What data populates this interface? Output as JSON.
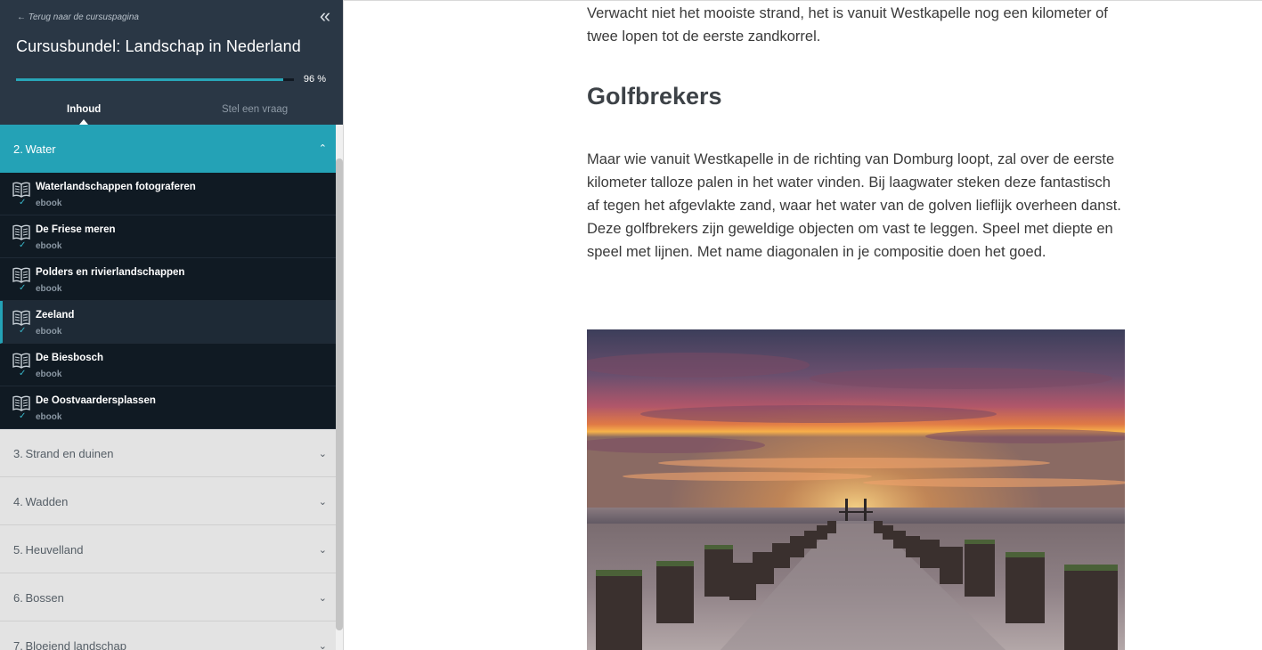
{
  "sidebar": {
    "back_label": "← Terug naar de cursuspagina",
    "collapse_icon": "double-chevron-left-icon",
    "course_title": "Cursusbundel: Landschap in Nederland",
    "progress": {
      "value": 0.96,
      "label": "96 %"
    },
    "tabs": [
      {
        "label": "Inhoud",
        "active": true
      },
      {
        "label": "Stel een vraag",
        "active": false
      }
    ],
    "active_section": {
      "label": "2. Water",
      "lessons": [
        {
          "title": "Waterlandschappen fotograferen",
          "type": "ebook",
          "icon": "open-book-icon",
          "done": true
        },
        {
          "title": "De Friese meren",
          "type": "ebook",
          "icon": "open-book-icon",
          "done": true
        },
        {
          "title": "Polders en rivierlandschappen",
          "type": "ebook",
          "icon": "open-book-icon",
          "done": true
        },
        {
          "title": "Zeeland",
          "type": "ebook",
          "icon": "open-book-icon",
          "done": true,
          "current": true
        },
        {
          "title": "De Biesbosch",
          "type": "ebook",
          "icon": "open-book-icon",
          "done": true
        },
        {
          "title": "De Oostvaardersplassen",
          "type": "ebook",
          "icon": "open-book-icon",
          "done": true
        }
      ]
    },
    "sections": [
      {
        "label": "3. Strand en duinen"
      },
      {
        "label": "4. Wadden"
      },
      {
        "label": "5. Heuvelland"
      },
      {
        "label": "6. Bossen"
      },
      {
        "label": "7. Bloeiend landschap"
      }
    ],
    "chevron_up": "⌃",
    "chevron_down": "⌄",
    "check_mark": "✓"
  },
  "main": {
    "intro_paragraph": "Verwacht niet het mooiste strand, het is vanuit Westkapelle nog een kilometer of twee lopen tot de eerste zandkorrel.",
    "heading": "Golfbrekers",
    "paragraph": "Maar wie vanuit Westkapelle in de richting van Domburg loopt, zal over de eerste kilometer talloze palen in het water vinden. Bij laagwater steken deze fantastisch af tegen het afgevlakte zand, waar het water van de golven lieflijk overheen danst. Deze golfbrekers zijn geweldige objecten om vast te leggen. Speel met diepte en speel met lijnen. Met name diagonalen in je compositie doen het goed."
  },
  "colors": {
    "accent": "#24a2b6",
    "sidebar_dark": "#2a3745",
    "lesson_bg": "#101a23"
  }
}
